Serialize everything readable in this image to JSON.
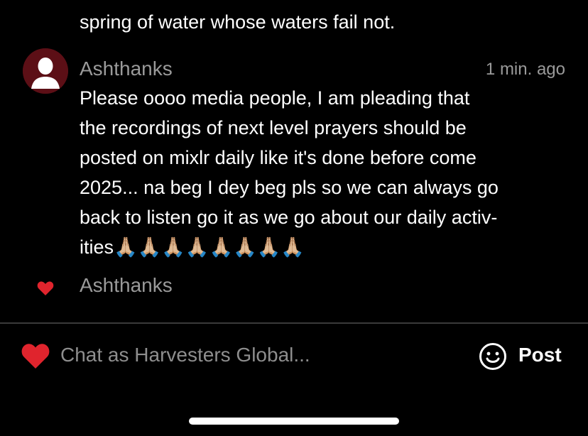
{
  "previous_message": {
    "last_line": "spring of water whose waters fail not."
  },
  "message": {
    "username": "Ashthanks",
    "timestamp": "1 min. ago",
    "text": "Please oooo media people, I am pleading that\nthe recordings of next level prayers should be\nposted on mixlr daily like it's done before come\n2025... na beg I dey beg pls so we can always go\nback to listen go it as we go about our daily activ-\nities🙏🏼🙏🏼🙏🏼🙏🏼🙏🏼🙏🏼🙏🏼🙏🏼",
    "avatar_color": "#5c0f16"
  },
  "likes": {
    "icon": "heart-icon",
    "liked_by": "Ashthanks",
    "color": "#e0242d"
  },
  "composer": {
    "placeholder": "Chat as Harvesters Global...",
    "post_label": "Post",
    "heart_icon": "heart-icon",
    "emoji_icon": "smiley-icon",
    "heart_color": "#e0242d"
  }
}
